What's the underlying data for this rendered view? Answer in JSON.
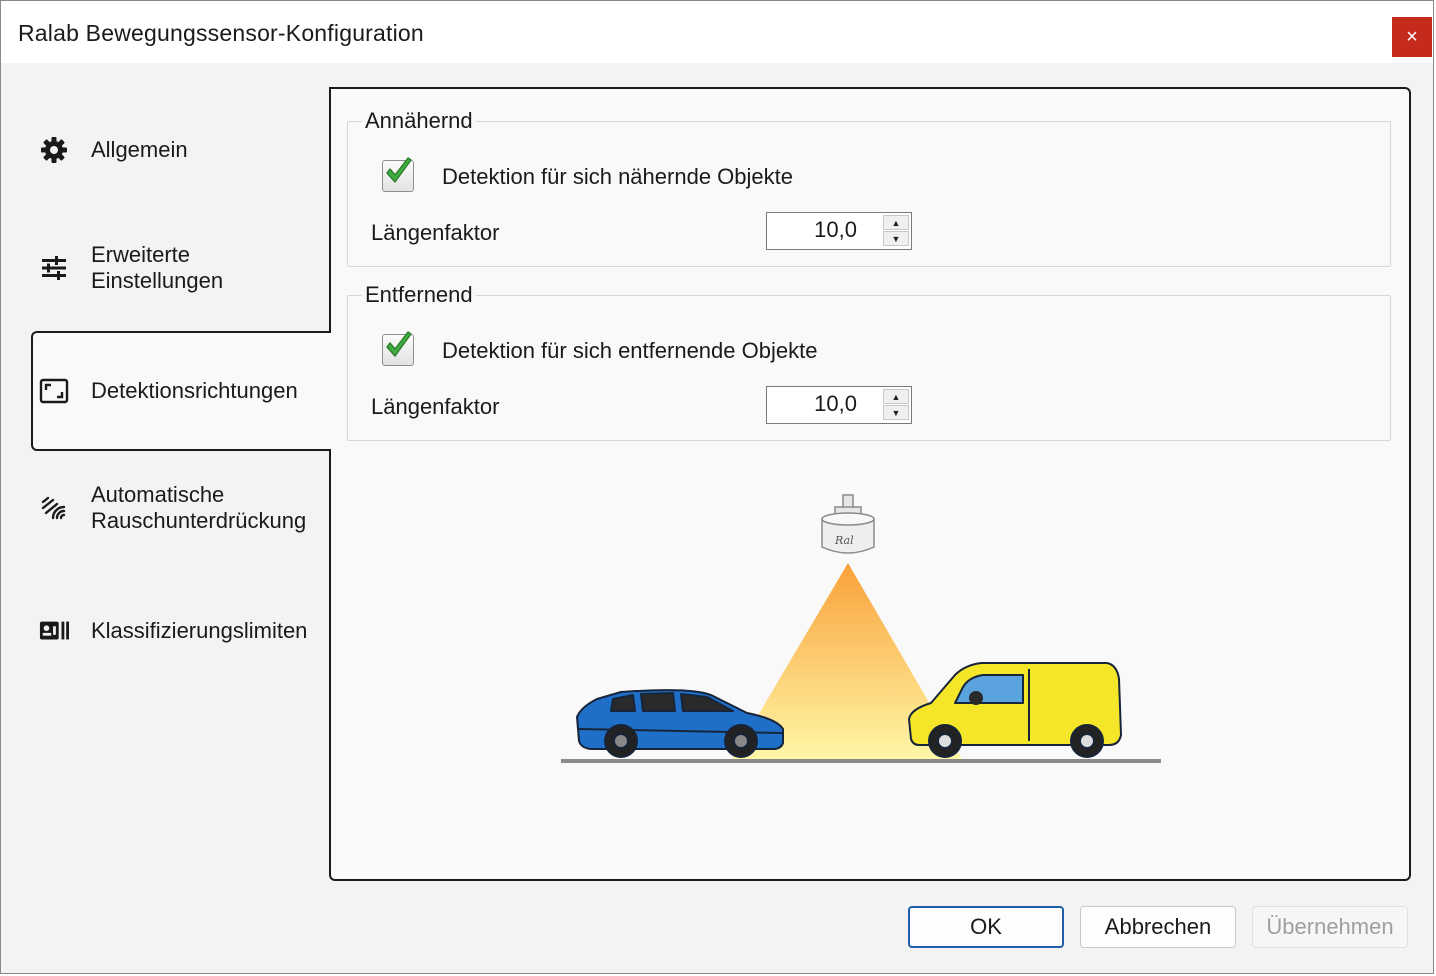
{
  "window": {
    "title": "Ralab Bewegungssensor-Konfiguration",
    "close_label": "×"
  },
  "tabs": [
    {
      "label": "Allgemein",
      "icon": "gear-icon"
    },
    {
      "label": "Erweiterte\nEinstellungen",
      "icon": "sliders-icon"
    },
    {
      "label": "Detektionsrichtungen",
      "icon": "frame-icon"
    },
    {
      "label": "Automatische\nRauschunterdrückung",
      "icon": "noise-icon"
    },
    {
      "label": "Klassifizierungslimiten",
      "icon": "id-card-icon"
    }
  ],
  "active_tab": "Detektionsrichtungen",
  "approaching": {
    "legend": "Annähernd",
    "checkbox_label": "Detektion für sich nähernde Objekte",
    "checked": true,
    "factor_label": "Längenfaktor",
    "factor_value": "10,0"
  },
  "receding": {
    "legend": "Entfernend",
    "checkbox_label": "Detektion für sich entfernende Objekte",
    "checked": true,
    "factor_label": "Längenfaktor",
    "factor_value": "10,0"
  },
  "illustration": {
    "sensor_logo_text": "Ral"
  },
  "buttons": {
    "ok": "OK",
    "cancel": "Abbrechen",
    "apply": "Übernehmen"
  },
  "colors": {
    "close": "#c42b1c",
    "default_button_border": "#1f5fa8",
    "check_green": "#3fae3f",
    "car_blue": "#1f6fc8",
    "van_yellow": "#f5e62a",
    "beam_orange": "#f9a13a"
  }
}
